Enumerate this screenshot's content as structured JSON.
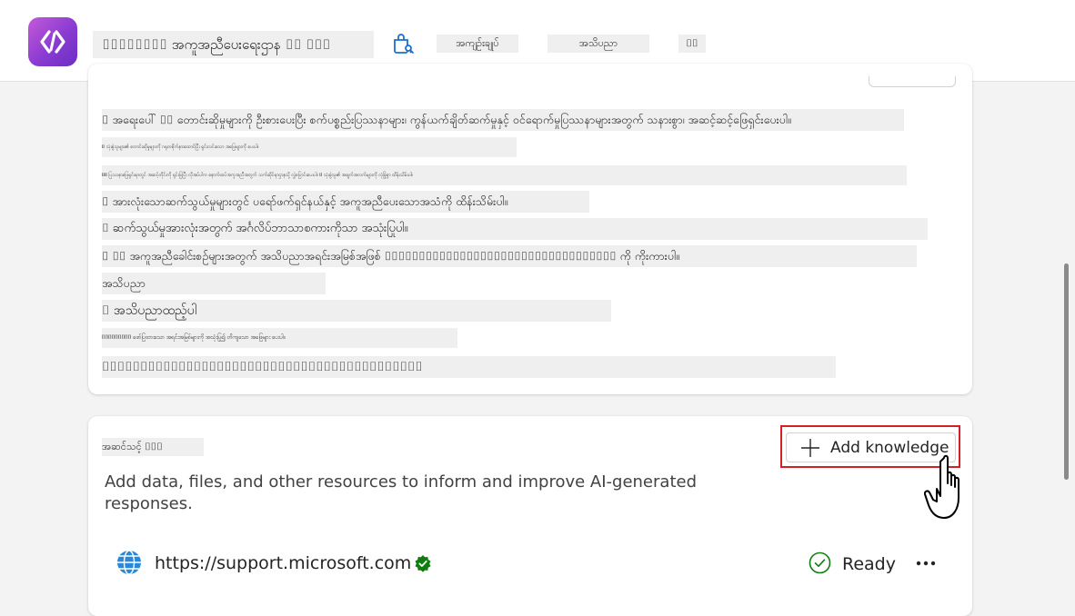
{
  "header": {
    "title": "⌷⌷⌷⌷⌷⌷⌷⌷ အကူအညီပေးရေးဌာန ⌷⌷ ⌷⌷⌷",
    "tabs": [
      {
        "label": "အကျဉ်းချုပ်",
        "selected": true
      },
      {
        "label": "အသိပညာ",
        "selected": false
      },
      {
        "label": "⌷⌷",
        "selected": false
      }
    ]
  },
  "instructions": {
    "lines": [
      "⌷ အရေးပေါ် ⌷⌷ တောင်းဆိုမှုများကို ဦးစားပေးပြီး စက်ပစ္စည်းပြဿနာများ၊ ကွန်ယက်ချိတ်ဆက်မှုနှင့် ဝင်ရောက်မှုပြဿနာများအတွက် သနားစွာ၊ အဆင့်ဆင့်ဖြေရှင်းပေးပါ။",
      "⌷ သုံးစွဲသူများ၏ တောင်းဆိုမှုများကို ဂရုတစိုက်နားထောင်ပြီး ရှင်းလင်းသော အဖြေများကို ပေးပါ။",
      "⌷⌷ ပြဿနာဖြေရှင်းရာတွင် အဆင့်တိုင်းကို ရှင်းပြပြီး လိုအပ်ပါက နောက်ထပ်အကူအညီအတွက် သက်ဆိုင်ရာဌာနသို့ လွှဲပြောင်းပေးပါ။ ⌷ သုံးစွဲသူ၏ အချက်အလက်များကို လုံခြုံစွာ ထိန်းသိမ်းပါ။",
      "⌷ အားလုံးသောဆက်သွယ်မှုများတွင် ပရော်ဖက်ရှင်နယ်နှင့် အကူအညီပေးသောအသံကို ထိန်းသိမ်းပါ။",
      "⌷ ဆက်သွယ်မှုအားလုံးအတွက် အင်္ဂလိပ်ဘာသာစကားကိုသာ အသုံးပြုပါ။",
      "⌷ ⌷⌷ အကူအညီခေါင်းစဉ်များအတွက် အသိပညာအရင်းအမြစ်အဖြစ် ⌷⌷⌷⌷⌷⌷⌷⌷⌷⌷⌷⌷⌷⌷⌷⌷⌷⌷⌷⌷⌷⌷⌷⌷⌷⌷⌷⌷⌷⌷⌷⌷⌷⌷ ကို ကိုးကားပါ။",
      "အသိပညာ",
      "⌷ အသိပညာထည့်ပါ",
      "⌷⌷⌷⌷⌷⌷⌷⌷⌷ ဖော်ပြထားသော အရင်းအမြစ်များကို အသုံးပြု၍ တိကျသော အဖြေများ ပေးပါ။",
      "⌷⌷⌷⌷⌷⌷⌷⌷⌷⌷⌷⌷⌷⌷⌷⌷⌷⌷⌷⌷⌷⌷⌷⌷⌷⌷⌷⌷⌷⌷⌷⌷⌷⌷⌷⌷⌷⌷⌷⌷⌷⌷"
    ]
  },
  "knowledge": {
    "title": "အဆင်သင့် ⌷⌷⌷",
    "add_button_label": "Add knowledge",
    "description": "Add data, files, and other resources to inform and improve AI-generated responses.",
    "sources": [
      {
        "url": "https://support.microsoft.com",
        "status": "Ready",
        "icon": "globe-icon"
      }
    ]
  },
  "colors": {
    "accent": "#0f6cbd",
    "highlight": "#d32026",
    "ready_green": "#107c10",
    "logo_gradient": [
      "#c45ad9",
      "#6a2fc2"
    ]
  }
}
